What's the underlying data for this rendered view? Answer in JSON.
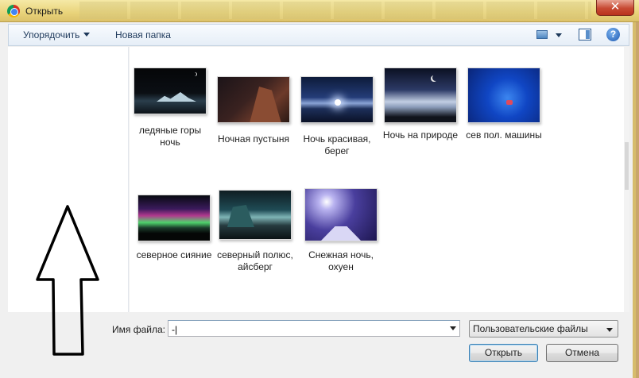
{
  "window": {
    "title": "Открыть",
    "close_glyph": "✕"
  },
  "toolbar": {
    "organize_label": "Упорядочить",
    "new_folder_label": "Новая папка",
    "help_glyph": "?"
  },
  "files": [
    {
      "label": "ледяные горы ночь"
    },
    {
      "label": "Ночная пустыня"
    },
    {
      "label": "Ночь красивая, берег"
    },
    {
      "label": "Ночь на природе"
    },
    {
      "label": "сев пол. машины"
    },
    {
      "label": "северное сияние"
    },
    {
      "label": "северный полюс, айсберг"
    },
    {
      "label": "Снежная ночь, охуен"
    }
  ],
  "footer": {
    "filename_label": "Имя файла:",
    "filename_value": "-|",
    "filetype_value": "Пользовательские файлы",
    "open_label": "Открыть",
    "cancel_label": "Отмена"
  },
  "colors": {
    "title_bar": "#e9d37a",
    "close_button": "#c74a33",
    "dialog_bg": "#f0f0f0",
    "toolbar_text": "#1e395b"
  },
  "icons": [
    "chrome-icon",
    "close-icon",
    "organize-caret-icon",
    "views-icon",
    "views-caret-icon",
    "preview-pane-icon",
    "help-icon",
    "dropdown-caret-icon",
    "up-arrow-annotation-icon"
  ]
}
